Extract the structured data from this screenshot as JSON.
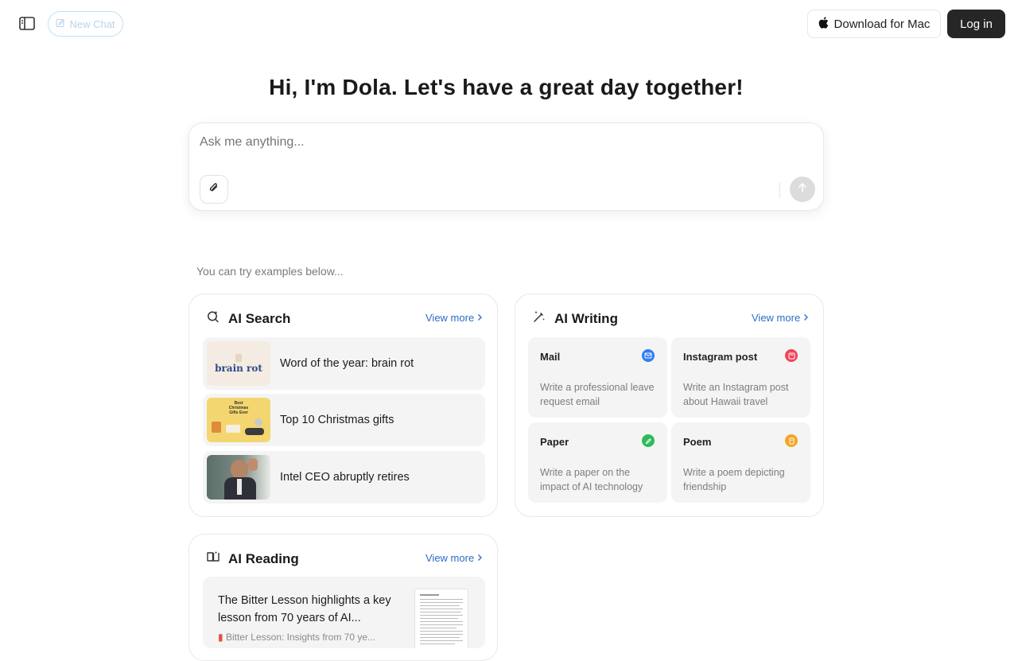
{
  "header": {
    "new_chat_label": "New Chat",
    "download_label": "Download for Mac",
    "login_label": "Log in"
  },
  "hero": {
    "title": "Hi, I'm Dola. Let's have a great day together!"
  },
  "composer": {
    "placeholder": "Ask me anything..."
  },
  "examples": {
    "label": "You can try examples below..."
  },
  "ai_search": {
    "title": "AI Search",
    "view_more": "View more",
    "thumb1_text": "brain rot",
    "thumb2_text": "Best Christmas Gifts Ever",
    "items": [
      {
        "label": "Word of the year: brain rot"
      },
      {
        "label": "Top 10 Christmas gifts"
      },
      {
        "label": "Intel CEO abruptly retires"
      }
    ]
  },
  "ai_writing": {
    "title": "AI Writing",
    "view_more": "View more",
    "items": [
      {
        "title": "Mail",
        "desc": "Write a professional leave request email",
        "icon": "mail-icon",
        "color": "#2f7cf6"
      },
      {
        "title": "Instagram post",
        "desc": "Write an Instagram post about Hawaii travel",
        "icon": "instagram-icon",
        "color": "#f0445a"
      },
      {
        "title": "Paper",
        "desc": "Write a paper on the impact of AI technology",
        "icon": "pencil-icon",
        "color": "#2fbb5a"
      },
      {
        "title": "Poem",
        "desc": "Write a poem depicting friendship",
        "icon": "book-icon",
        "color": "#f5a524"
      }
    ]
  },
  "ai_reading": {
    "title": "AI Reading",
    "view_more": "View more",
    "item": {
      "text": "The Bitter Lesson highlights a key lesson from 70 years of AI...",
      "sub": "Bitter Lesson: Insights from 70 ye..."
    }
  }
}
